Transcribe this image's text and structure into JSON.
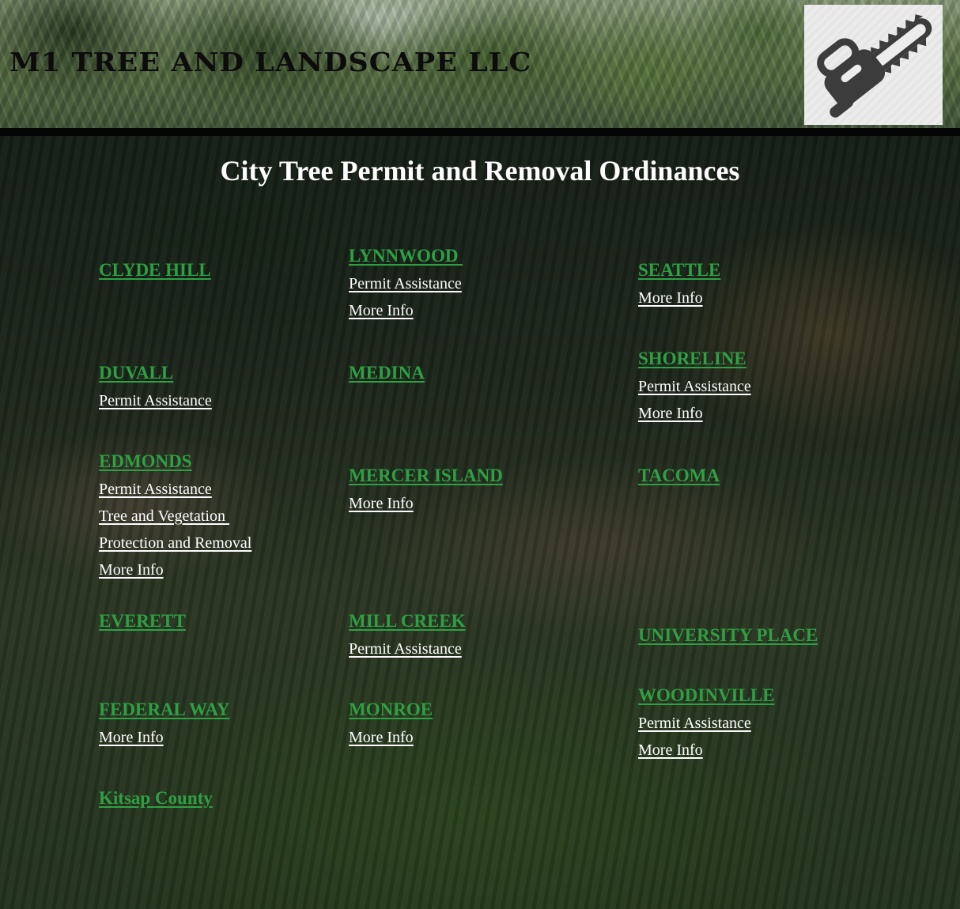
{
  "site": {
    "title": "M1 TREE AND LANDSCAPE LLC",
    "logo_icon": "chainsaw-icon"
  },
  "page": {
    "heading": "City Tree Permit and Removal Ordinances"
  },
  "colors": {
    "city_link": "#2ea043",
    "sub_link": "#ffffff",
    "header_bar": "#050505"
  },
  "cities": {
    "clyde_hill": {
      "name": "CLYDE HILL"
    },
    "duvall": {
      "name": "DUVALL",
      "permit": "Permit Assistance"
    },
    "edmonds": {
      "name": "EDMONDS",
      "permit": "Permit Assistance",
      "tree_line1": "Tree and Vegetation ",
      "tree_line2": "Protection and Removal",
      "more": "More Info"
    },
    "everett": {
      "name": "EVERETT"
    },
    "federal_way": {
      "name": "FEDERAL WAY",
      "more": "More Info"
    },
    "kitsap": {
      "name": "Kitsap County"
    },
    "lynnwood": {
      "name": "LYNNWOOD ",
      "permit": "Permit Assistance",
      "more": "More Info"
    },
    "medina": {
      "name": "MEDINA"
    },
    "mercer_island": {
      "name": "MERCER ISLAND",
      "more": "More Info"
    },
    "mill_creek": {
      "name": "MILL CREEK",
      "permit": "Permit Assistance"
    },
    "monroe": {
      "name": "MONROE",
      "more": "More Info"
    },
    "seattle": {
      "name": "SEATTLE",
      "more": "More Info"
    },
    "shoreline": {
      "name": "SHORELINE",
      "permit": "Permit Assistance",
      "more": "More Info"
    },
    "tacoma": {
      "name": "TACOMA"
    },
    "university_place": {
      "name": "UNIVERSITY PLACE"
    },
    "woodinville": {
      "name": "WOODINVILLE",
      "permit": "Permit Assistance",
      "more": "More Info"
    }
  }
}
